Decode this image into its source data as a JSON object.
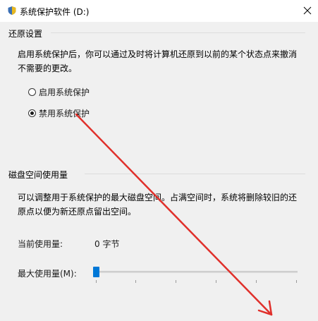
{
  "window": {
    "title": "系统保护软件 (D:)"
  },
  "restore": {
    "heading": "还原设置",
    "description": "启用系统保护后，你可以通过及时将计算机还原到以前的某个状态点来撤消不需要的更改。",
    "options": [
      {
        "label": "启用系统保护",
        "checked": false
      },
      {
        "label": "禁用系统保护",
        "checked": true
      }
    ]
  },
  "disk": {
    "heading": "磁盘空间使用量",
    "description": "可以调整用于系统保护的最大磁盘空间。占满空间时，系统将删除较旧的还原点以便为新还原点留出空间。",
    "current_label": "当前使用量:",
    "current_value": "0 字节",
    "max_label": "最大使用量(M):",
    "max_usage_fraction": 0
  },
  "colors": {
    "accent": "#0078d7",
    "annotation_arrow": "#e0302b"
  },
  "icons": {
    "window": "shield-icon",
    "close": "close-icon"
  }
}
